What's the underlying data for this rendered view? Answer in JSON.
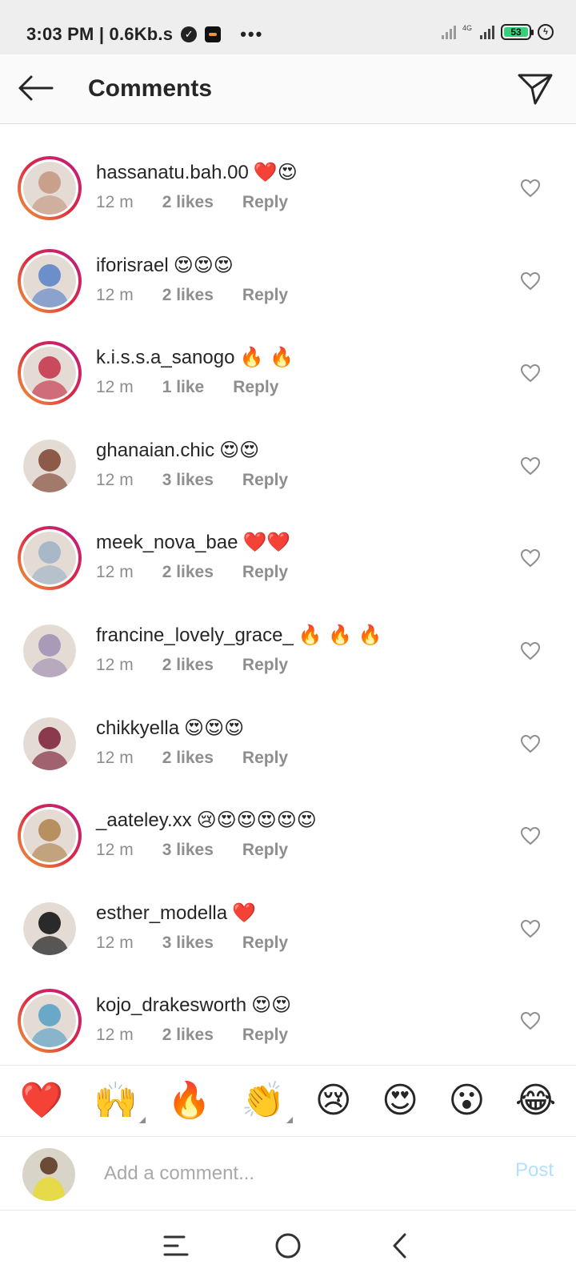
{
  "status_bar": {
    "time": "3:03 PM | 0.6Kb.s",
    "network": "4G",
    "battery": "53"
  },
  "header": {
    "title": "Comments"
  },
  "comments": [
    {
      "username": "hassanatu.bah.00",
      "emoji": "❤️😍",
      "time": "12 m",
      "likes": "2 likes",
      "reply": "Reply",
      "story_ring": true,
      "avatar_color": "#c8a08c"
    },
    {
      "username": "iforisrael",
      "emoji": "😍😍😍",
      "time": "12 m",
      "likes": "2 likes",
      "reply": "Reply",
      "story_ring": true,
      "avatar_color": "#6d8fc9"
    },
    {
      "username": "k.i.s.s.a_sanogo",
      "emoji": "🔥 🔥",
      "time": "12 m",
      "likes": "1 like",
      "reply": "Reply",
      "story_ring": true,
      "avatar_color": "#c84a5c"
    },
    {
      "username": "ghanaian.chic",
      "emoji": "😍😍",
      "time": "12 m",
      "likes": "3 likes",
      "reply": "Reply",
      "story_ring": false,
      "avatar_color": "#8b5a48"
    },
    {
      "username": "meek_nova_bae",
      "emoji": "❤️❤️",
      "time": "12 m",
      "likes": "2 likes",
      "reply": "Reply",
      "story_ring": true,
      "avatar_color": "#a8b8c8"
    },
    {
      "username": "francine_lovely_grace_",
      "emoji": "🔥 🔥 🔥",
      "time": "12 m",
      "likes": "2 likes",
      "reply": "Reply",
      "story_ring": false,
      "avatar_color": "#a89ab8"
    },
    {
      "username": "chikkyella",
      "emoji": "😍😍😍",
      "time": "12 m",
      "likes": "2 likes",
      "reply": "Reply",
      "story_ring": false,
      "avatar_color": "#8a3a4a"
    },
    {
      "username": "_aateley.xx",
      "emoji": "😢😍😍😍😍😍",
      "time": "12 m",
      "likes": "3 likes",
      "reply": "Reply",
      "story_ring": true,
      "avatar_color": "#b89060"
    },
    {
      "username": "esther_modella",
      "emoji": "❤️",
      "time": "12 m",
      "likes": "3 likes",
      "reply": "Reply",
      "story_ring": false,
      "avatar_color": "#2a2a2a"
    },
    {
      "username": "kojo_drakesworth",
      "emoji": "😍😍",
      "time": "12 m",
      "likes": "2 likes",
      "reply": "Reply",
      "story_ring": true,
      "avatar_color": "#6aa8c8"
    }
  ],
  "reactions": [
    {
      "glyph": "❤️",
      "name": "red-heart",
      "has_variants": false
    },
    {
      "glyph": "🙌",
      "name": "raised-hands",
      "has_variants": true
    },
    {
      "glyph": "🔥",
      "name": "fire",
      "has_variants": false
    },
    {
      "glyph": "👏",
      "name": "clapping-hands",
      "has_variants": true
    },
    {
      "glyph": "😢",
      "name": "crying-face",
      "has_variants": false
    },
    {
      "glyph": "😍",
      "name": "heart-eyes",
      "has_variants": false
    },
    {
      "glyph": "😮",
      "name": "surprised-face",
      "has_variants": false
    },
    {
      "glyph": "😂",
      "name": "tears-of-joy",
      "has_variants": false
    }
  ],
  "composer": {
    "placeholder": "Add a comment...",
    "post_label": "Post",
    "avatar_color": "#e6d94a"
  },
  "colors": {
    "accent_disabled": "#b2dffc",
    "meta_gray": "#8e8e8e",
    "text": "#262626"
  }
}
